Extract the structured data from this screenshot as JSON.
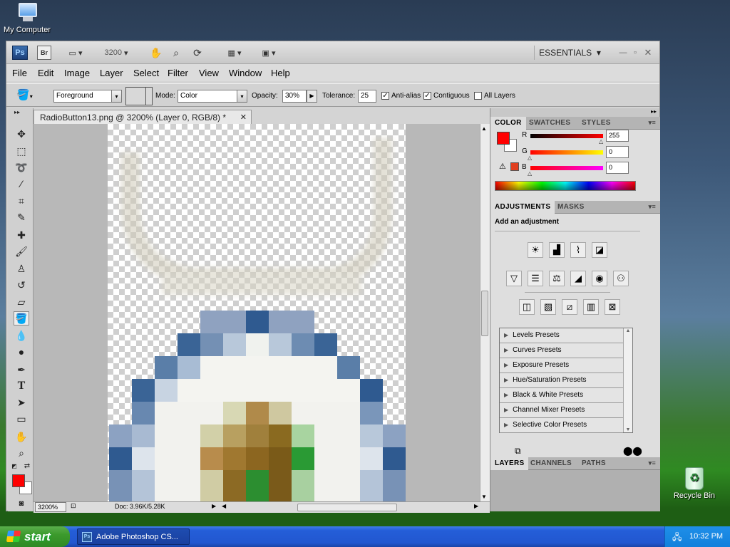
{
  "desktop": {
    "my_computer": "My Computer",
    "recycle_bin": "Recycle Bin"
  },
  "titlebar": {
    "ps_logo": "Ps",
    "br_logo": "Br",
    "zoom": "3200",
    "workspace": "ESSENTIALS"
  },
  "menu": [
    "File",
    "Edit",
    "Image",
    "Layer",
    "Select",
    "Filter",
    "View",
    "Window",
    "Help"
  ],
  "options": {
    "fill_source": "Foreground",
    "mode_label": "Mode:",
    "mode_value": "Color",
    "opacity_label": "Opacity:",
    "opacity_value": "30%",
    "tolerance_label": "Tolerance:",
    "tolerance_value": "25",
    "anti_alias": "Anti-alias",
    "contiguous": "Contiguous",
    "all_layers": "All Layers"
  },
  "document": {
    "tab_title": "RadioButton13.png @ 3200% (Layer 0, RGB/8) *",
    "zoom": "3200%",
    "doc_info": "Doc: 3.96K/5.28K"
  },
  "color_panel": {
    "tabs": [
      "COLOR",
      "SWATCHES",
      "STYLES"
    ],
    "r_label": "R",
    "g_label": "G",
    "b_label": "B",
    "r_value": "255",
    "g_value": "0",
    "b_value": "0",
    "foreground": "#ff0000"
  },
  "adjustments": {
    "tabs": [
      "ADJUSTMENTS",
      "MASKS"
    ],
    "heading": "Add an adjustment",
    "presets": [
      "Levels Presets",
      "Curves Presets",
      "Exposure Presets",
      "Hue/Saturation Presets",
      "Black & White Presets",
      "Channel Mixer Presets",
      "Selective Color Presets"
    ]
  },
  "layers_panel": {
    "tabs": [
      "LAYERS",
      "CHANNELS",
      "PATHS"
    ]
  },
  "taskbar": {
    "start": "start",
    "task": "Adobe Photoshop CS...",
    "clock": "10:32 PM"
  }
}
